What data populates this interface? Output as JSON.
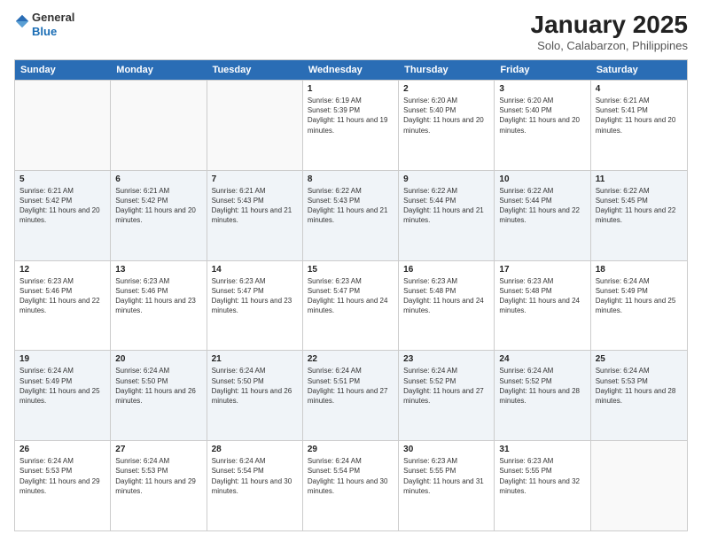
{
  "logo": {
    "general": "General",
    "blue": "Blue"
  },
  "title": "January 2025",
  "subtitle": "Solo, Calabarzon, Philippines",
  "days": [
    "Sunday",
    "Monday",
    "Tuesday",
    "Wednesday",
    "Thursday",
    "Friday",
    "Saturday"
  ],
  "weeks": [
    [
      {
        "day": "",
        "sunrise": "",
        "sunset": "",
        "daylight": ""
      },
      {
        "day": "",
        "sunrise": "",
        "sunset": "",
        "daylight": ""
      },
      {
        "day": "",
        "sunrise": "",
        "sunset": "",
        "daylight": ""
      },
      {
        "day": "1",
        "sunrise": "Sunrise: 6:19 AM",
        "sunset": "Sunset: 5:39 PM",
        "daylight": "Daylight: 11 hours and 19 minutes."
      },
      {
        "day": "2",
        "sunrise": "Sunrise: 6:20 AM",
        "sunset": "Sunset: 5:40 PM",
        "daylight": "Daylight: 11 hours and 20 minutes."
      },
      {
        "day": "3",
        "sunrise": "Sunrise: 6:20 AM",
        "sunset": "Sunset: 5:40 PM",
        "daylight": "Daylight: 11 hours and 20 minutes."
      },
      {
        "day": "4",
        "sunrise": "Sunrise: 6:21 AM",
        "sunset": "Sunset: 5:41 PM",
        "daylight": "Daylight: 11 hours and 20 minutes."
      }
    ],
    [
      {
        "day": "5",
        "sunrise": "Sunrise: 6:21 AM",
        "sunset": "Sunset: 5:42 PM",
        "daylight": "Daylight: 11 hours and 20 minutes."
      },
      {
        "day": "6",
        "sunrise": "Sunrise: 6:21 AM",
        "sunset": "Sunset: 5:42 PM",
        "daylight": "Daylight: 11 hours and 20 minutes."
      },
      {
        "day": "7",
        "sunrise": "Sunrise: 6:21 AM",
        "sunset": "Sunset: 5:43 PM",
        "daylight": "Daylight: 11 hours and 21 minutes."
      },
      {
        "day": "8",
        "sunrise": "Sunrise: 6:22 AM",
        "sunset": "Sunset: 5:43 PM",
        "daylight": "Daylight: 11 hours and 21 minutes."
      },
      {
        "day": "9",
        "sunrise": "Sunrise: 6:22 AM",
        "sunset": "Sunset: 5:44 PM",
        "daylight": "Daylight: 11 hours and 21 minutes."
      },
      {
        "day": "10",
        "sunrise": "Sunrise: 6:22 AM",
        "sunset": "Sunset: 5:44 PM",
        "daylight": "Daylight: 11 hours and 22 minutes."
      },
      {
        "day": "11",
        "sunrise": "Sunrise: 6:22 AM",
        "sunset": "Sunset: 5:45 PM",
        "daylight": "Daylight: 11 hours and 22 minutes."
      }
    ],
    [
      {
        "day": "12",
        "sunrise": "Sunrise: 6:23 AM",
        "sunset": "Sunset: 5:46 PM",
        "daylight": "Daylight: 11 hours and 22 minutes."
      },
      {
        "day": "13",
        "sunrise": "Sunrise: 6:23 AM",
        "sunset": "Sunset: 5:46 PM",
        "daylight": "Daylight: 11 hours and 23 minutes."
      },
      {
        "day": "14",
        "sunrise": "Sunrise: 6:23 AM",
        "sunset": "Sunset: 5:47 PM",
        "daylight": "Daylight: 11 hours and 23 minutes."
      },
      {
        "day": "15",
        "sunrise": "Sunrise: 6:23 AM",
        "sunset": "Sunset: 5:47 PM",
        "daylight": "Daylight: 11 hours and 24 minutes."
      },
      {
        "day": "16",
        "sunrise": "Sunrise: 6:23 AM",
        "sunset": "Sunset: 5:48 PM",
        "daylight": "Daylight: 11 hours and 24 minutes."
      },
      {
        "day": "17",
        "sunrise": "Sunrise: 6:23 AM",
        "sunset": "Sunset: 5:48 PM",
        "daylight": "Daylight: 11 hours and 24 minutes."
      },
      {
        "day": "18",
        "sunrise": "Sunrise: 6:24 AM",
        "sunset": "Sunset: 5:49 PM",
        "daylight": "Daylight: 11 hours and 25 minutes."
      }
    ],
    [
      {
        "day": "19",
        "sunrise": "Sunrise: 6:24 AM",
        "sunset": "Sunset: 5:49 PM",
        "daylight": "Daylight: 11 hours and 25 minutes."
      },
      {
        "day": "20",
        "sunrise": "Sunrise: 6:24 AM",
        "sunset": "Sunset: 5:50 PM",
        "daylight": "Daylight: 11 hours and 26 minutes."
      },
      {
        "day": "21",
        "sunrise": "Sunrise: 6:24 AM",
        "sunset": "Sunset: 5:50 PM",
        "daylight": "Daylight: 11 hours and 26 minutes."
      },
      {
        "day": "22",
        "sunrise": "Sunrise: 6:24 AM",
        "sunset": "Sunset: 5:51 PM",
        "daylight": "Daylight: 11 hours and 27 minutes."
      },
      {
        "day": "23",
        "sunrise": "Sunrise: 6:24 AM",
        "sunset": "Sunset: 5:52 PM",
        "daylight": "Daylight: 11 hours and 27 minutes."
      },
      {
        "day": "24",
        "sunrise": "Sunrise: 6:24 AM",
        "sunset": "Sunset: 5:52 PM",
        "daylight": "Daylight: 11 hours and 28 minutes."
      },
      {
        "day": "25",
        "sunrise": "Sunrise: 6:24 AM",
        "sunset": "Sunset: 5:53 PM",
        "daylight": "Daylight: 11 hours and 28 minutes."
      }
    ],
    [
      {
        "day": "26",
        "sunrise": "Sunrise: 6:24 AM",
        "sunset": "Sunset: 5:53 PM",
        "daylight": "Daylight: 11 hours and 29 minutes."
      },
      {
        "day": "27",
        "sunrise": "Sunrise: 6:24 AM",
        "sunset": "Sunset: 5:53 PM",
        "daylight": "Daylight: 11 hours and 29 minutes."
      },
      {
        "day": "28",
        "sunrise": "Sunrise: 6:24 AM",
        "sunset": "Sunset: 5:54 PM",
        "daylight": "Daylight: 11 hours and 30 minutes."
      },
      {
        "day": "29",
        "sunrise": "Sunrise: 6:24 AM",
        "sunset": "Sunset: 5:54 PM",
        "daylight": "Daylight: 11 hours and 30 minutes."
      },
      {
        "day": "30",
        "sunrise": "Sunrise: 6:23 AM",
        "sunset": "Sunset: 5:55 PM",
        "daylight": "Daylight: 11 hours and 31 minutes."
      },
      {
        "day": "31",
        "sunrise": "Sunrise: 6:23 AM",
        "sunset": "Sunset: 5:55 PM",
        "daylight": "Daylight: 11 hours and 32 minutes."
      },
      {
        "day": "",
        "sunrise": "",
        "sunset": "",
        "daylight": ""
      }
    ]
  ]
}
